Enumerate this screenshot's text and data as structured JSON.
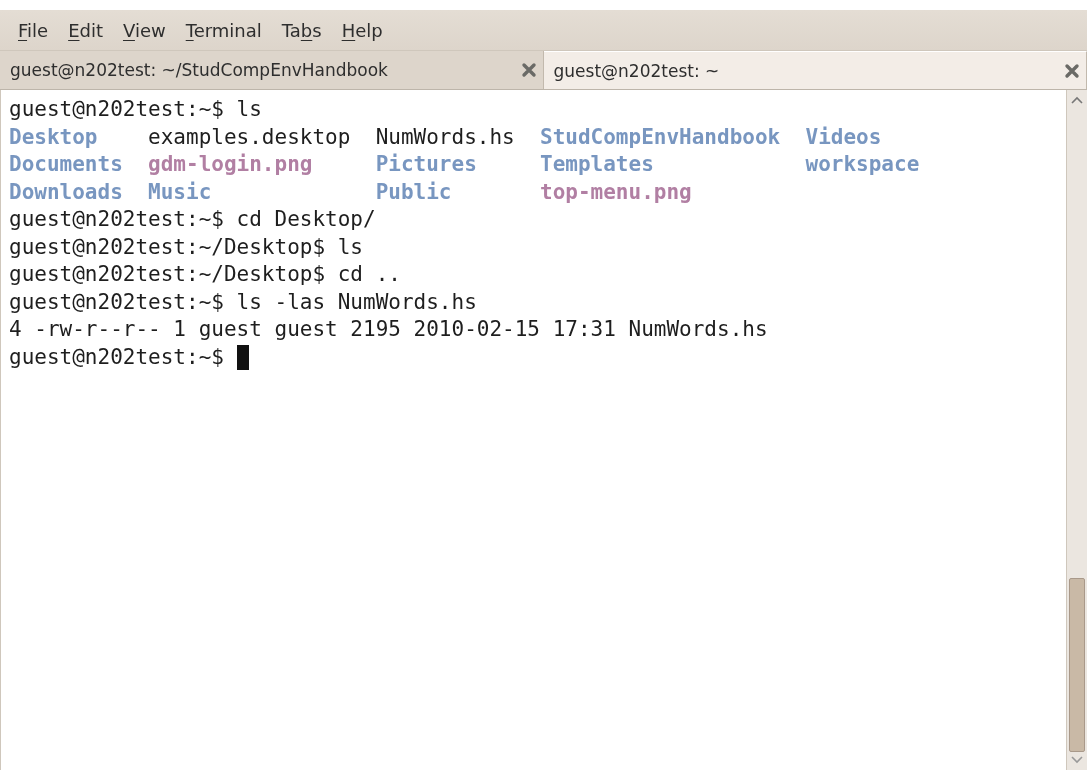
{
  "menu": [
    {
      "parts": [
        {
          "text": "F",
          "underlined": true
        },
        {
          "text": "ile",
          "underlined": false
        }
      ]
    },
    {
      "parts": [
        {
          "text": "E",
          "underlined": true
        },
        {
          "text": "dit",
          "underlined": false
        }
      ]
    },
    {
      "parts": [
        {
          "text": "V",
          "underlined": true
        },
        {
          "text": "iew",
          "underlined": false
        }
      ]
    },
    {
      "parts": [
        {
          "text": "T",
          "underlined": true
        },
        {
          "text": "erminal",
          "underlined": false
        }
      ]
    },
    {
      "parts": [
        {
          "text": "Ta",
          "underlined": false
        },
        {
          "text": "b",
          "underlined": true
        },
        {
          "text": "s",
          "underlined": false
        }
      ]
    },
    {
      "parts": [
        {
          "text": "H",
          "underlined": true
        },
        {
          "text": "elp",
          "underlined": false
        }
      ]
    }
  ],
  "tabs": [
    {
      "title": "guest@n202test: ~/StudCompEnvHandbook",
      "selected": false
    },
    {
      "title": "guest@n202test: ~",
      "selected": true
    }
  ],
  "terminal": {
    "lines": [
      {
        "kind": "text",
        "text": "guest@n202test:~$ ls"
      },
      {
        "kind": "listing",
        "columns": [
          [
            {
              "name": "Desktop",
              "kind": "dir"
            },
            {
              "name": "Documents",
              "kind": "dir"
            },
            {
              "name": "Downloads",
              "kind": "dir"
            }
          ],
          [
            {
              "name": "examples.desktop",
              "kind": "file"
            },
            {
              "name": "gdm-login.png",
              "kind": "image"
            },
            {
              "name": "Music",
              "kind": "dir"
            }
          ],
          [
            {
              "name": "NumWords.hs",
              "kind": "file"
            },
            {
              "name": "Pictures",
              "kind": "dir"
            },
            {
              "name": "Public",
              "kind": "dir"
            }
          ],
          [
            {
              "name": "StudCompEnvHandbook",
              "kind": "dir"
            },
            {
              "name": "Templates",
              "kind": "dir"
            },
            {
              "name": "top-menu.png",
              "kind": "image"
            }
          ],
          [
            {
              "name": "Videos",
              "kind": "dir"
            },
            {
              "name": "workspace",
              "kind": "dir"
            }
          ]
        ]
      },
      {
        "kind": "text",
        "text": "guest@n202test:~$ cd Desktop/"
      },
      {
        "kind": "text",
        "text": "guest@n202test:~/Desktop$ ls"
      },
      {
        "kind": "text",
        "text": "guest@n202test:~/Desktop$ cd .."
      },
      {
        "kind": "text",
        "text": "guest@n202test:~$ ls -las NumWords.hs"
      },
      {
        "kind": "text",
        "text": "4 -rw-r--r-- 1 guest guest 2195 2010-02-15 17:31 NumWords.hs"
      },
      {
        "kind": "prompt",
        "text": "guest@n202test:~$ ",
        "cursor": true
      }
    ]
  }
}
